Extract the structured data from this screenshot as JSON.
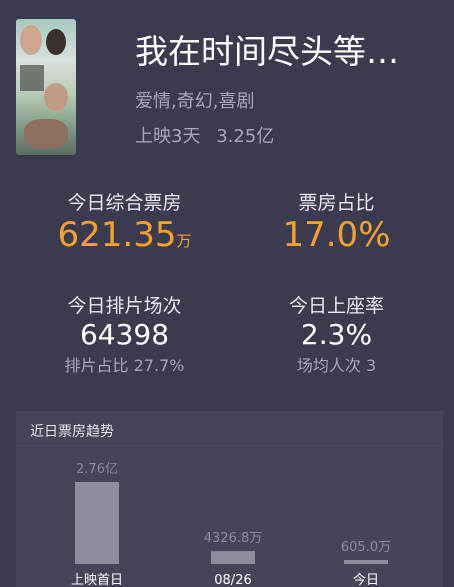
{
  "movie": {
    "title": "我在时间尽头等…",
    "genre": "爱情,奇幻,喜剧",
    "release_days": "上映3天",
    "total_box": "3.25亿"
  },
  "stats": {
    "box_label": "今日综合票房",
    "box_value": "621.35",
    "box_unit": "万",
    "share_label": "票房占比",
    "share_value": "17.0%",
    "sessions_label": "今日排片场次",
    "sessions_value": "64398",
    "sessions_sub": "排片占比 27.7%",
    "seat_label": "今日上座率",
    "seat_value": "2.3%",
    "seat_sub": "场均人次 3"
  },
  "colors": {
    "accent": "#f5a22d",
    "background": "#3b3b4f",
    "panel": "#45455a",
    "bar": "#8d8d9c"
  },
  "trend": {
    "title": "近日票房趋势"
  },
  "chart_data": {
    "type": "bar",
    "categories": [
      "上映首日",
      "08/26",
      "今日"
    ],
    "values": [
      27600,
      4326.8,
      605.0
    ],
    "unit": "万",
    "data_labels": [
      "2.76亿",
      "4326.8万",
      "605.0万"
    ]
  }
}
